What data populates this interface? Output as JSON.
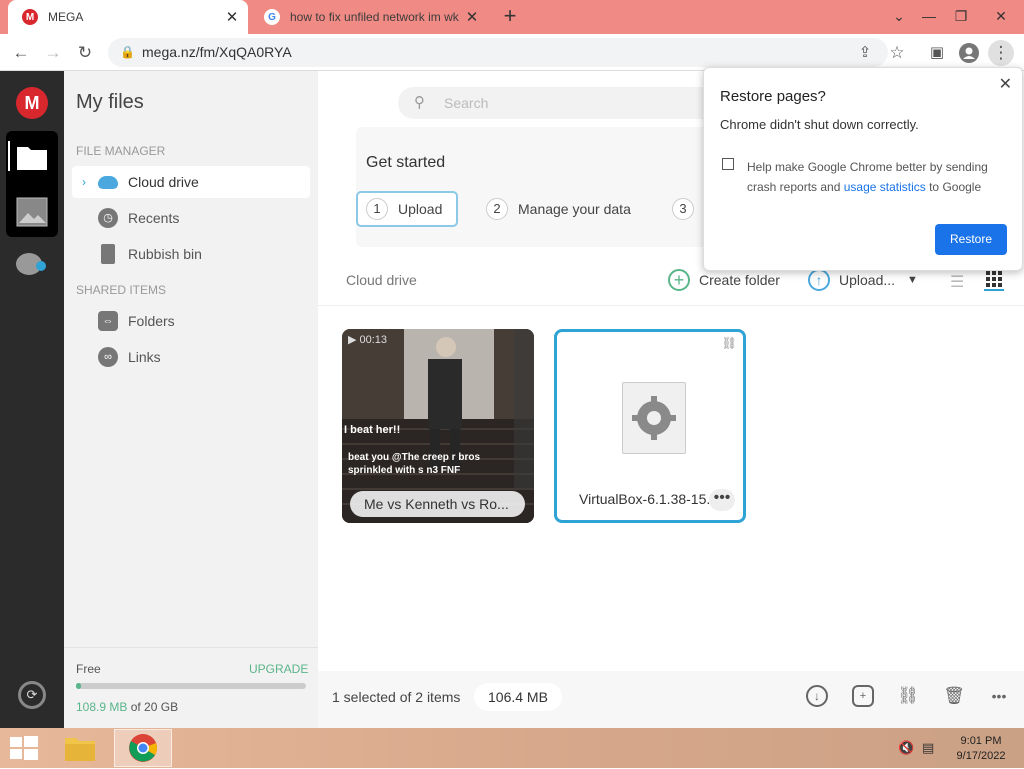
{
  "browser": {
    "tabs": [
      {
        "title": "MEGA",
        "favicon": "mega-icon"
      },
      {
        "title": "how to fix unfiled network im wk",
        "favicon": "google-icon"
      }
    ],
    "new_tab": "+",
    "url": "mega.nz/fm/XqQA0RYA"
  },
  "sidebar": {
    "heading": "My files",
    "file_manager_label": "FILE MANAGER",
    "file_items": [
      {
        "label": "Cloud drive",
        "icon": "cloud-icon"
      },
      {
        "label": "Recents",
        "icon": "clock-icon"
      },
      {
        "label": "Rubbish bin",
        "icon": "trash-icon"
      }
    ],
    "shared_label": "SHARED ITEMS",
    "shared_items": [
      {
        "label": "Folders",
        "icon": "shared-folder-icon"
      },
      {
        "label": "Links",
        "icon": "link-icon"
      }
    ],
    "storage": {
      "free_label": "Free",
      "upgrade_label": "UPGRADE",
      "used": "108.9 MB",
      "of_total": " of 20 GB",
      "used_fraction": 0.005
    }
  },
  "main": {
    "search_placeholder": "Search",
    "get_started": {
      "title": "Get started",
      "steps": [
        {
          "num": "1",
          "label": "Upload"
        },
        {
          "num": "2",
          "label": "Manage your data"
        },
        {
          "num": "3",
          "label": ""
        }
      ]
    },
    "breadcrumb": "Cloud drive",
    "create_folder": "Create folder",
    "upload": "Upload...",
    "files": [
      {
        "name": "Me vs Kenneth vs Ro...",
        "duration": "00:13",
        "overlay_1": "I beat her!!",
        "overlay_2": "beat you @The creep r bros sprinkled with s n3 FNF"
      },
      {
        "name": "VirtualBox-6.1.38-15..."
      }
    ],
    "selection_text": "1 selected of 2 items",
    "selection_size": "106.4 MB"
  },
  "restore_popup": {
    "title": "Restore pages?",
    "message": "Chrome didn't shut down correctly.",
    "checkbox_text_1": "Help make Google Chrome better by sending",
    "checkbox_text_2": "crash reports and ",
    "checkbox_link": "usage statistics",
    "checkbox_text_3": " to Google",
    "button": "Restore"
  },
  "taskbar": {
    "time": "9:01 PM",
    "date": "9/17/2022"
  },
  "colors": {
    "tab_strip": "#f08a84",
    "mega_red": "#d9272e",
    "accent_blue": "#1a73e8",
    "selection_blue": "#2fa3d6",
    "upgrade_green": "#5bb58a"
  }
}
